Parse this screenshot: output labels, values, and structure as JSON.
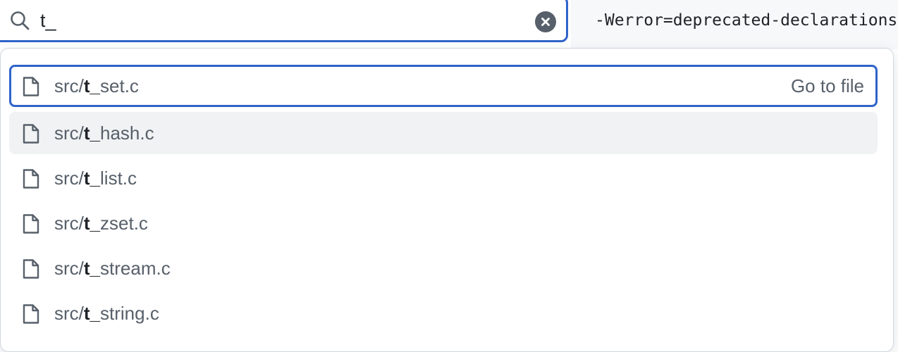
{
  "background_code": "-Werror=deprecated-declarations",
  "search": {
    "value": "t_",
    "icon": "search-icon",
    "clear_icon": "close-circle-icon"
  },
  "results": {
    "action_label": "Go to file",
    "items": [
      {
        "prefix": "src/",
        "match": "t_",
        "suffix": "set.c",
        "icon": "file-icon",
        "state": "focused"
      },
      {
        "prefix": "src/",
        "match": "t_",
        "suffix": "hash.c",
        "icon": "file-icon",
        "state": "hovered"
      },
      {
        "prefix": "src/",
        "match": "t_",
        "suffix": "list.c",
        "icon": "file-icon",
        "state": "normal"
      },
      {
        "prefix": "src/",
        "match": "t_",
        "suffix": "zset.c",
        "icon": "file-icon",
        "state": "normal"
      },
      {
        "prefix": "src/",
        "match": "t_",
        "suffix": "stream.c",
        "icon": "file-icon",
        "state": "normal"
      },
      {
        "prefix": "src/",
        "match": "t_",
        "suffix": "string.c",
        "icon": "file-icon",
        "state": "normal"
      }
    ]
  },
  "colors": {
    "focus_border": "#2f63c9",
    "hover_background": "#f0f2f4",
    "muted_text": "#57606a"
  }
}
